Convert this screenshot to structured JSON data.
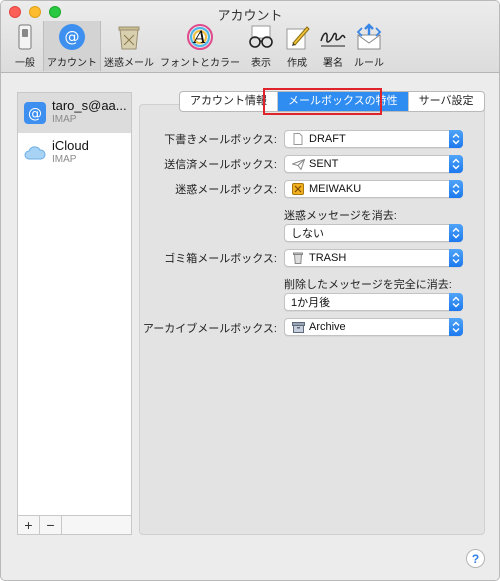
{
  "window": {
    "title": "アカウント"
  },
  "toolbar": {
    "items": [
      {
        "label": "一般",
        "icon": "general-switch-icon"
      },
      {
        "label": "アカウント",
        "icon": "at-sign-icon"
      },
      {
        "label": "迷惑メール",
        "icon": "trash-junk-icon"
      },
      {
        "label": "フォントとカラー",
        "icon": "font-color-icon"
      },
      {
        "label": "表示",
        "icon": "glasses-icon"
      },
      {
        "label": "作成",
        "icon": "pencil-icon"
      },
      {
        "label": "署名",
        "icon": "signature-icon"
      },
      {
        "label": "ルール",
        "icon": "rules-envelope-icon"
      }
    ]
  },
  "accounts": [
    {
      "name": "taro_s@aa...",
      "type": "IMAP",
      "icon": "at-sign-icon"
    },
    {
      "name": "iCloud",
      "type": "IMAP",
      "icon": "cloud-icon"
    }
  ],
  "list_buttons": {
    "add": "+",
    "remove": "−"
  },
  "tabs": [
    {
      "label": "アカウント情報"
    },
    {
      "label": "メールボックスの特性"
    },
    {
      "label": "サーバ設定"
    }
  ],
  "settings": {
    "drafts": {
      "label": "下書きメールボックス:",
      "value": "DRAFT"
    },
    "sent": {
      "label": "送信済メールボックス:",
      "value": "SENT"
    },
    "junk": {
      "label": "迷惑メールボックス:",
      "value": "MEIWAKU"
    },
    "junk_erase": {
      "label": "迷惑メッセージを消去:",
      "value": "しない"
    },
    "trash": {
      "label": "ゴミ箱メールボックス:",
      "value": "TRASH"
    },
    "trash_erase": {
      "label": "削除したメッセージを完全に消去:",
      "value": "1か月後"
    },
    "archive": {
      "label": "アーカイブメールボックス:",
      "value": "Archive"
    }
  },
  "help": {
    "label": "?"
  },
  "colors": {
    "accent": "#2f8cf0",
    "highlight": "#e0232b"
  }
}
